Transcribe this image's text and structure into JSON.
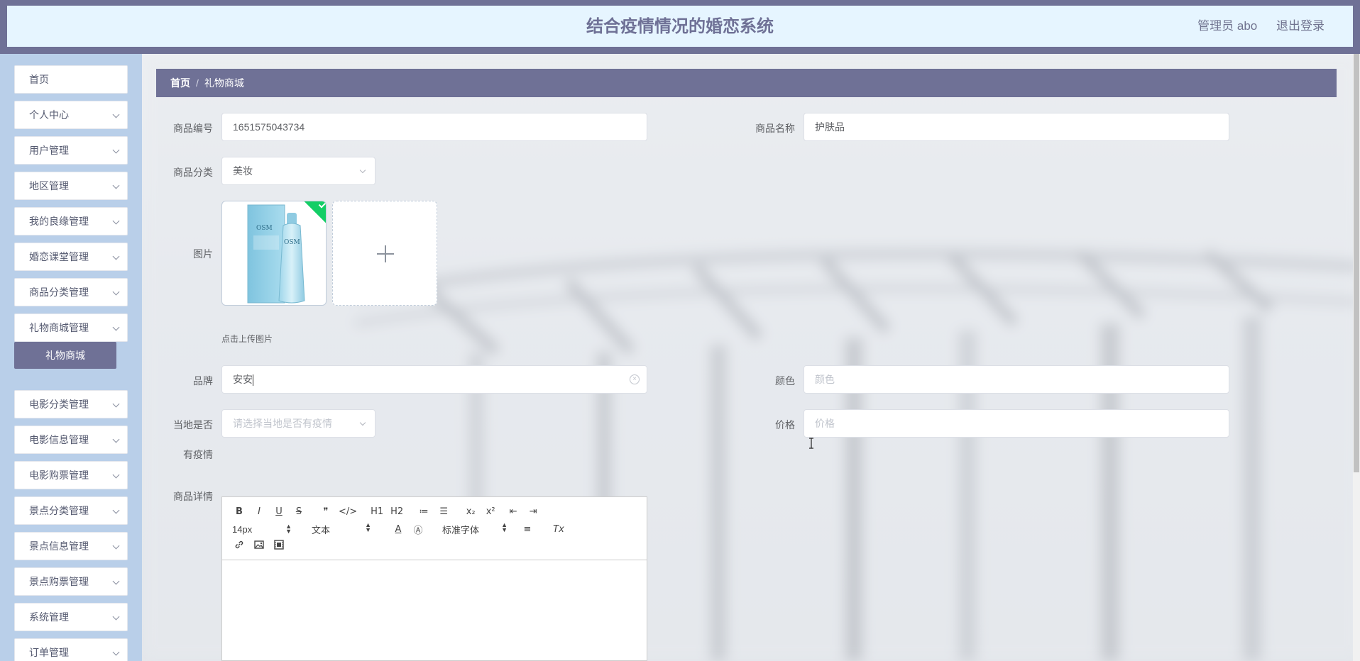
{
  "header": {
    "title": "结合疫情情况的婚恋系统",
    "user_label": "管理员 abo",
    "logout_label": "退出登录"
  },
  "sidebar": {
    "items": [
      {
        "label": "首页",
        "has_arrow": false
      },
      {
        "label": "个人中心",
        "has_arrow": true
      },
      {
        "label": "用户管理",
        "has_arrow": true
      },
      {
        "label": "地区管理",
        "has_arrow": true
      },
      {
        "label": "我的良缘管理",
        "has_arrow": true
      },
      {
        "label": "婚恋课堂管理",
        "has_arrow": true
      },
      {
        "label": "商品分类管理",
        "has_arrow": true
      },
      {
        "label": "礼物商城管理",
        "has_arrow": true
      },
      {
        "label": "电影分类管理",
        "has_arrow": true
      },
      {
        "label": "电影信息管理",
        "has_arrow": true
      },
      {
        "label": "电影购票管理",
        "has_arrow": true
      },
      {
        "label": "景点分类管理",
        "has_arrow": true
      },
      {
        "label": "景点信息管理",
        "has_arrow": true
      },
      {
        "label": "景点购票管理",
        "has_arrow": true
      },
      {
        "label": "系统管理",
        "has_arrow": true
      },
      {
        "label": "订单管理",
        "has_arrow": true
      }
    ],
    "active_sub": "礼物商城"
  },
  "breadcrumb": {
    "home": "首页",
    "separator": "/",
    "current": "礼物商城"
  },
  "form": {
    "code_label": "商品编号",
    "code_value": "1651575043734",
    "name_label": "商品名称",
    "name_value": "护肤品",
    "category_label": "商品分类",
    "category_value": "美妆",
    "image_label": "图片",
    "image_tip": "点击上传图片",
    "brand_label": "品牌",
    "brand_value": "安安",
    "color_label": "颜色",
    "color_placeholder": "颜色",
    "epidemic_label_line1": "当地是否",
    "epidemic_label_line2": "有疫情",
    "epidemic_placeholder": "请选择当地是否有疫情",
    "price_label": "价格",
    "price_placeholder": "价格",
    "detail_label": "商品详情"
  },
  "editor": {
    "font_size": "14px",
    "header_picker": "文本",
    "font_family": "标准字体",
    "row1_buttons": [
      "B",
      "I",
      "U",
      "S",
      "❞",
      "</>",
      "H1",
      "H2",
      "≔",
      "☰",
      "x₂",
      "x²",
      "⇤",
      "⇥"
    ],
    "row2_icons": [
      "A",
      "Ⓐ",
      "≡",
      "Tx"
    ],
    "row3_icons": [
      "link-icon",
      "image-icon",
      "video-icon"
    ]
  },
  "product_image": {
    "brand_text": "OSM"
  },
  "colors": {
    "accent": "#6f7196",
    "header_bg": "#e6f5ff",
    "sidebar_bg": "#b9cfe9",
    "success": "#13ce66"
  }
}
